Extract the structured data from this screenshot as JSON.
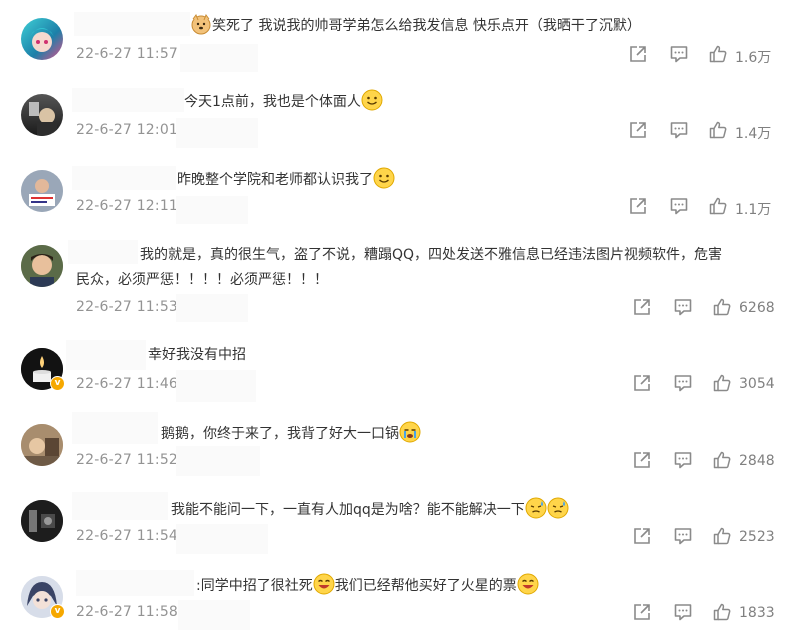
{
  "comments": [
    {
      "text": "笑死了 我说我的帅哥学弟怎么给我发信息 快乐点开（我晒干了沉默）",
      "date": "22-6-27 11:57",
      "likes": "1.6万"
    },
    {
      "text": "今天1点前，我也是个体面人",
      "date": "22-6-27 12:01",
      "likes": "1.4万"
    },
    {
      "text": "昨晚整个学院和老师都认识我了",
      "date": "22-6-27 12:11",
      "likes": "1.1万"
    },
    {
      "text": "我的就是，真的很生气，盗了不说，糟蹋QQ，四处发送不雅信息已经违法图片视频软件，危害",
      "text2": "民众，必须严惩！！！！必须严惩！！！",
      "date": "22-6-27 11:53",
      "likes": "6268"
    },
    {
      "text": "幸好我没有中招",
      "date": "22-6-27 11:46",
      "likes": "3054"
    },
    {
      "text": "鹅鹅，你终于来了，我背了好大一口锅",
      "date": "22-6-27 11:52",
      "likes": "2848"
    },
    {
      "text": "我能不能问一下，一直有人加qq是为啥？能不能解决一下",
      "date": "22-6-27 11:54",
      "likes": "2523"
    },
    {
      "text_a": ":同学中招了很社死",
      "text_b": "我们已经帮他买好了火星的票",
      "date": "22-6-27 11:58",
      "likes": "1833"
    }
  ]
}
